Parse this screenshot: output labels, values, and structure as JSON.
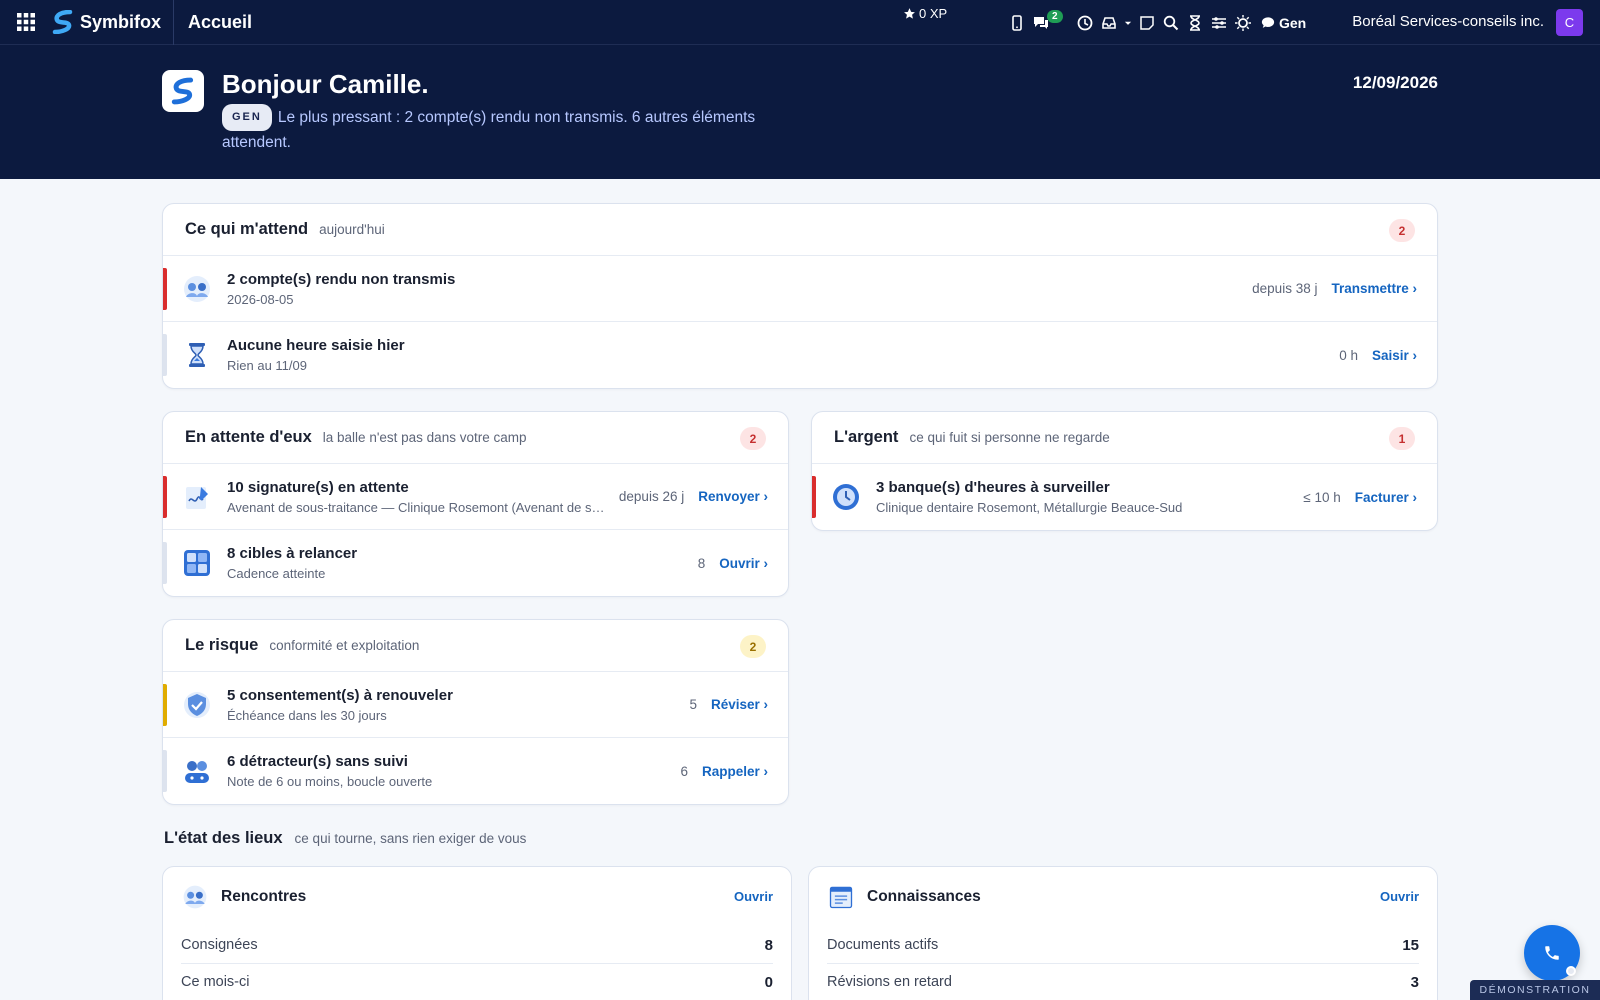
{
  "topbar": {
    "brand": "Symbifox",
    "page": "Accueil",
    "xp": "0 XP",
    "chat_badge": "2",
    "gen_label": "Gen",
    "company": "Boréal Services-conseils inc.",
    "avatar_initial": "C"
  },
  "hero": {
    "greeting": "Bonjour Camille.",
    "pill": "GEN",
    "message": "Le plus pressant : 2 compte(s) rendu non transmis. 6 autres éléments attendent.",
    "date": "12/09/2026"
  },
  "cards": {
    "awaiting": {
      "title": "Ce qui m'attend",
      "subtitle": "aujourd'hui",
      "count": "2",
      "rows": [
        {
          "title": "2 compte(s) rendu non transmis",
          "detail": "2026-08-05",
          "meta": "depuis 38 j",
          "action": "Transmettre ›",
          "bar": "red"
        },
        {
          "title": "Aucune heure saisie hier",
          "detail": "Rien au 11/09",
          "meta": "0 h",
          "action": "Saisir ›",
          "bar": "grey"
        }
      ]
    },
    "waiting_them": {
      "title": "En attente d'eux",
      "subtitle": "la balle n'est pas dans votre camp",
      "count": "2",
      "rows": [
        {
          "title": "10 signature(s) en attente",
          "detail": "Avenant de sous-traitance — Clinique Rosemont (Avenant de sous-traitance)",
          "meta": "depuis 26 j",
          "action": "Renvoyer ›",
          "bar": "red"
        },
        {
          "title": "8 cibles à relancer",
          "detail": "Cadence atteinte",
          "meta": "8",
          "action": "Ouvrir ›",
          "bar": "grey"
        }
      ]
    },
    "money": {
      "title": "L'argent",
      "subtitle": "ce qui fuit si personne ne regarde",
      "count": "1",
      "rows": [
        {
          "title": "3 banque(s) d'heures à surveiller",
          "detail": "Clinique dentaire Rosemont, Métallurgie Beauce-Sud",
          "meta": "≤ 10 h",
          "action": "Facturer ›",
          "bar": "red"
        }
      ]
    },
    "risk": {
      "title": "Le risque",
      "subtitle": "conformité et exploitation",
      "count": "2",
      "rows": [
        {
          "title": "5 consentement(s) à renouveler",
          "detail": "Échéance dans les 30 jours",
          "meta": "5",
          "action": "Réviser ›",
          "bar": "yellow"
        },
        {
          "title": "6 détracteur(s) sans suivi",
          "detail": "Note de 6 ou moins, boucle ouverte",
          "meta": "6",
          "action": "Rappeler ›",
          "bar": "grey"
        }
      ]
    }
  },
  "state": {
    "title": "L'état des lieux",
    "subtitle": "ce qui tourne, sans rien exiger de vous",
    "meetings": {
      "title": "Rencontres",
      "open": "Ouvrir",
      "rows": [
        {
          "label": "Consignées",
          "value": "8"
        },
        {
          "label": "Ce mois-ci",
          "value": "0"
        }
      ]
    },
    "knowledge": {
      "title": "Connaissances",
      "open": "Ouvrir",
      "rows": [
        {
          "label": "Documents actifs",
          "value": "15"
        },
        {
          "label": "Révisions en retard",
          "value": "3"
        }
      ]
    }
  },
  "demo_label": "DÉMONSTRATION",
  "colors": {
    "navy": "#0c1a3f",
    "accent": "#1565c0",
    "danger": "#d92d2d",
    "warning": "#e0ac00"
  }
}
